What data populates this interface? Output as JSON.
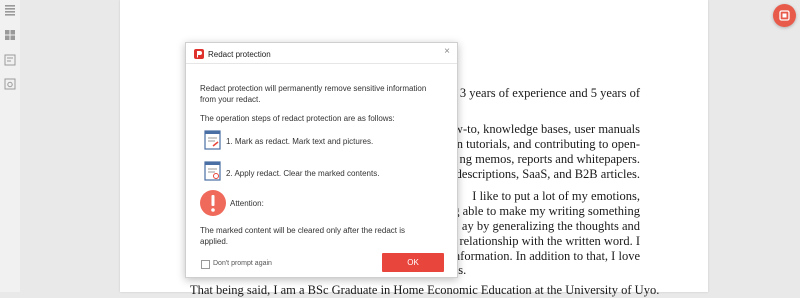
{
  "sidebar": {
    "icons": [
      "list-icon",
      "thumbnails-icon",
      "edit-notes-icon",
      "search-panel-icon"
    ]
  },
  "document": {
    "lines": [
      "3 years of experience and 5 years of",
      "w-to, knowledge bases, user manuals",
      "on tutorials, and contributing to open-",
      "ng memos, reports and whitepapers.",
      "t descriptions, SaaS, and B2B articles.",
      "I like to put a lot of my emotions,",
      "g able to make my writing something",
      "ay by generalizing the thoughts and",
      "relationship with the written word. I",
      "nformation. In addition to that, I love",
      "ds.",
      "That being said, I am a BSc Graduate in Home Economic Education at the University of Uyo."
    ]
  },
  "dialog": {
    "title": "Redact protection",
    "intro": "Redact protection will permanently remove sensitive information\nfrom your redact.",
    "steps_heading": "The operation steps of redact protection are as follows:",
    "step1": "1. Mark as redact. Mark text and pictures.",
    "step2": "2. Apply redact. Clear the marked contents.",
    "attention": "Attention:",
    "note": "The marked content will be cleared only after the redact is\napplied.",
    "checkbox_label": "Don't prompt again",
    "ok_label": "OK"
  },
  "colors": {
    "accent": "#e8453c",
    "fab": "#e85b4b"
  }
}
